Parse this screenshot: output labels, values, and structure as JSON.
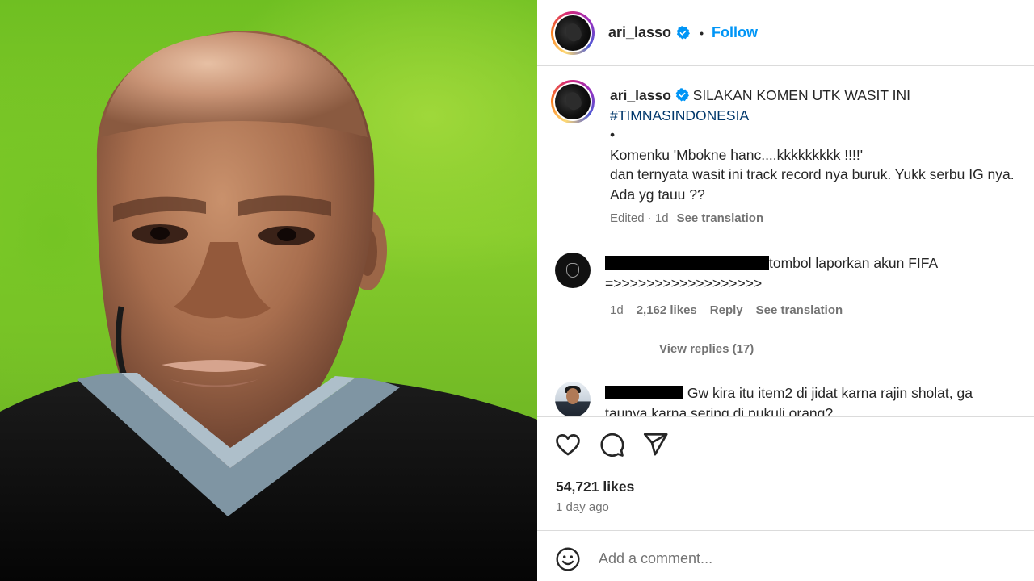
{
  "post": {
    "image_alt": "Close-up photo of a bald referee in a dark shirt on a green pitch"
  },
  "header": {
    "username": "ari_lasso",
    "separator": "•",
    "follow_label": "Follow",
    "verified_icon": "verified-badge-icon"
  },
  "caption": {
    "username": "ari_lasso",
    "line1": "SILAKAN KOMEN UTK WASIT INI",
    "hashtag": "#TIMNASINDONESIA",
    "bullet": "•",
    "line3": "Komenku 'Mbokne hanc....kkkkkkkkk !!!!'",
    "line4": "dan ternyata wasit ini track record nya buruk. Yukk serbu IG nya.",
    "line5": "Ada yg tauu ??",
    "edited": "Edited",
    "age": "1d",
    "see_translation": "See translation"
  },
  "comments": [
    {
      "text_line1": "tombol laporkan akun FIFA",
      "text_line2": "=>>>>>>>>>>>>>>>>>>",
      "age": "1d",
      "likes": "2,162 likes",
      "reply": "Reply",
      "see_translation": "See translation",
      "view_replies": "View replies (17)"
    },
    {
      "text_line1": "Gw kira itu item2 di jidat karna rajin sholat, ga",
      "text_line2": "taunya karna sering di pukuli orang?"
    }
  ],
  "actions": {
    "like_icon": "heart-icon",
    "comment_icon": "comment-icon",
    "share_icon": "share-icon",
    "likes_count": "54,721 likes",
    "posted": "1 day ago"
  },
  "add_comment": {
    "emoji_icon": "emoji-icon",
    "placeholder": "Add a comment..."
  },
  "colors": {
    "link_blue": "#0095f6",
    "hashtag_blue": "#00376b",
    "secondary_text": "#737373",
    "divider": "#dbdbdb"
  }
}
